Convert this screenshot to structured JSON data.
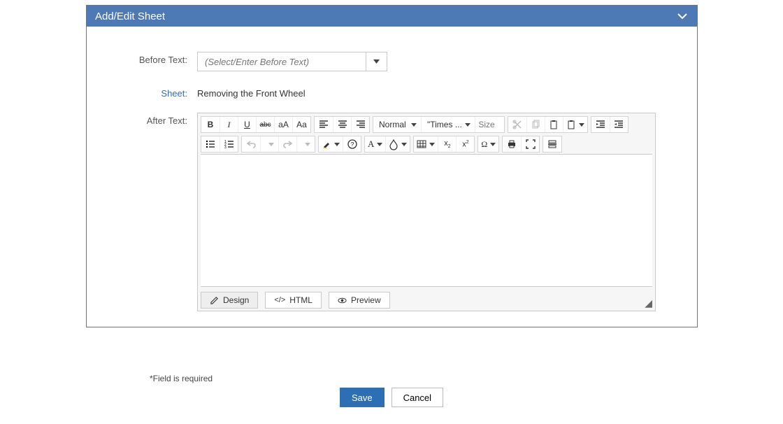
{
  "panel": {
    "title": "Add/Edit Sheet"
  },
  "labels": {
    "before_text": "Before Text:",
    "sheet": "Sheet:",
    "after_text": "After Text:"
  },
  "before_text": {
    "placeholder": "(Select/Enter Before Text)",
    "value": ""
  },
  "sheet": {
    "value": "Removing the Front Wheel"
  },
  "editor": {
    "content": "",
    "para_style": "Normal",
    "font_family": "\"Times ...",
    "font_size_placeholder": "Size",
    "tabs": {
      "design": "Design",
      "html": "HTML",
      "preview": "Preview"
    }
  },
  "omega": "Ω",
  "aa_small": "aA",
  "aa_big": "Aa",
  "footer": {
    "note": "*Field is required",
    "save": "Save",
    "cancel": "Cancel"
  }
}
